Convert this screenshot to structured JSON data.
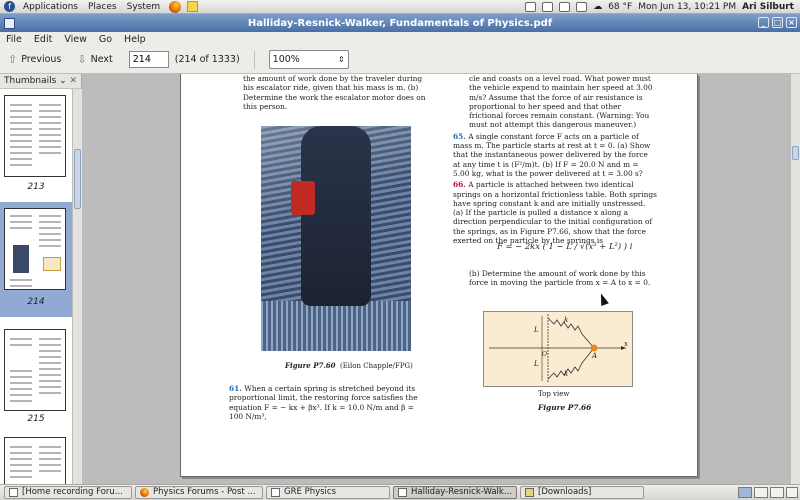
{
  "topbar": {
    "menus": [
      "Applications",
      "Places",
      "System"
    ],
    "weather": "68 °F",
    "datetime": "Mon Jun 13, 10:21 PM",
    "user": "Ari Silburt"
  },
  "window": {
    "title": "Halliday-Resnick-Walker, Fundamentals of Physics.pdf"
  },
  "menubar": [
    "File",
    "Edit",
    "View",
    "Go",
    "Help"
  ],
  "toolbar": {
    "previous_label": "Previous",
    "next_label": "Next",
    "page_value": "214",
    "page_count": "(214 of 1333)",
    "zoom_value": "100%"
  },
  "sidebar": {
    "title": "Thumbnails",
    "thumbnails": [
      {
        "label": "213"
      },
      {
        "label": "214",
        "selected": true
      },
      {
        "label": "215"
      }
    ]
  },
  "document": {
    "left_top": "the amount of work done by the traveler during his escalator ride, given that his mass is m. (b) Determine the work the escalator motor does on this person.",
    "figure_caption": "Figure P7.60",
    "figure_credit": "(Eilon Chapple/FPG)",
    "p61_num": "61.",
    "p61_text": "When a certain spring is stretched beyond its proportional limit, the restoring force satisfies the equation F = − kx + βx³. If k = 10.0 N/m and β = 100 N/m³,",
    "right_top": "cle and coasts on a level road. What power must the vehicle expend to maintain her speed at 3.00 m/s? Assume that the force of air resistance is proportional to her speed and that other frictional forces remain constant. (Warning: You must not attempt this dangerous maneuver.)",
    "p65_num": "65.",
    "p65_text": "A single constant force F acts on a particle of mass m. The particle starts at rest at t = 0. (a) Show that the instantaneous power delivered by the force at any time t is (F²/m)t. (b) If F = 20.0 N and m = 5.00 kg, what is the power delivered at t = 3.00 s?",
    "p66_num": "66.",
    "p66_text": "A particle is attached between two identical springs on a horizontal frictionless table. Both springs have spring constant k and are initially unstressed. (a) If the particle is pulled a distance x along a direction perpendicular to the initial configuration of the springs, as in Figure P7.66, show that the force exerted on the particle by the springs is",
    "equation": "F = − 2kx ( 1 − L / √(x² + L²) ) i",
    "p66b_text": "(b) Determine the amount of work done by this force in moving the particle from x = A to x = 0.",
    "fig_label_k": "k",
    "fig_label_L": "L",
    "fig_label_A": "A",
    "fig_label_x": "x",
    "fig_label_O": "O",
    "top_view": "Top view",
    "figure2_label": "Figure P7.66"
  },
  "taskbar": [
    {
      "label": "[Home recording Foru...",
      "icon": "window-icon"
    },
    {
      "label": "Physics Forums - Post ...",
      "icon": "firefox-icon"
    },
    {
      "label": "GRE Physics",
      "icon": "window-icon"
    },
    {
      "label": "Halliday-Resnick-Walk...",
      "icon": "pdf-icon",
      "active": true
    },
    {
      "label": "[Downloads]",
      "icon": "folder-icon"
    }
  ],
  "colors": {
    "titlebar": "#5b7fb3",
    "selection": "#90aad4",
    "problem_number": "#1f6fb3",
    "problem_number_highlight": "#c4103b"
  }
}
